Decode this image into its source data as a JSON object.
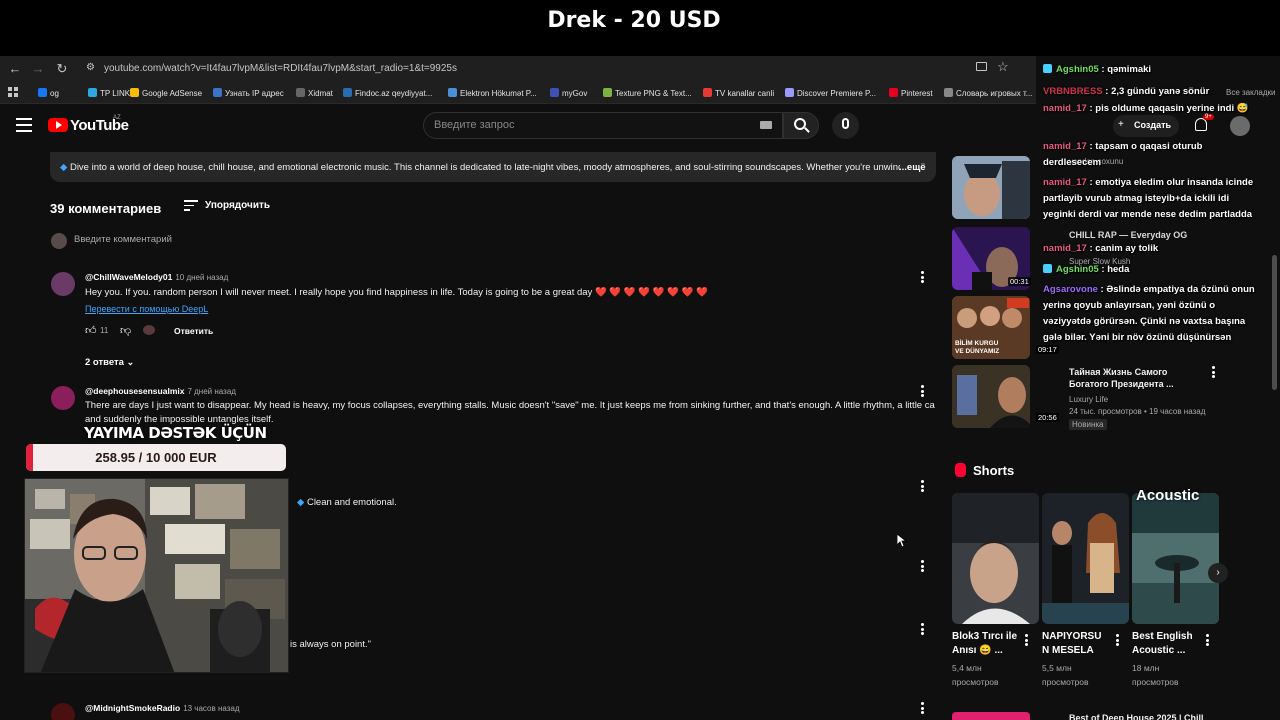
{
  "stream": {
    "banner_title": "Drek - 20 USD",
    "support_label": "YAYIMA DƏSTƏK ÜÇÜN",
    "donation_text": "258.95 / 10 000 EUR",
    "donation_progress": 0.026
  },
  "browser": {
    "url": "youtube.com/watch?v=It4fau7lvpM&list=RDIt4fau7lvpM&start_radio=1&t=9925s",
    "bookmarks": [
      {
        "label": "og",
        "color": "#1877f2"
      },
      {
        "label": "TP LINK",
        "color": "#2ea7e0"
      },
      {
        "label": "Google AdSense",
        "color": "#fbbc04"
      },
      {
        "label": "Узнать IP адрес",
        "color": "#3a74c4"
      },
      {
        "label": "Xidmat",
        "color": "#666666"
      },
      {
        "label": "Findoc.az qeydiyyat...",
        "color": "#2b6cb0"
      },
      {
        "label": "Elektron Hökumət P...",
        "color": "#4a90d9"
      },
      {
        "label": "myGov",
        "color": "#3f51b5"
      },
      {
        "label": "Texture PNG & Text...",
        "color": "#7cb342"
      },
      {
        "label": "TV kanallar canli",
        "color": "#e53935"
      },
      {
        "label": "Discover Premiere P...",
        "color": "#9999ff"
      },
      {
        "label": "Pinterest",
        "color": "#e60023"
      },
      {
        "label": "Словарь игровых т...",
        "color": "#888888"
      }
    ],
    "all_bookmarks": "Все закладки"
  },
  "youtube": {
    "logo_text": "YouTube",
    "region": "AZ",
    "search_placeholder": "Введите запрос",
    "create_label": "Создать",
    "notif_count": "9+"
  },
  "description": {
    "text": "Dive into a world of deep house, chill house, and emotional electronic music. This channel is dedicated to late-night vibes, moody atmospheres, and soul-stirring soundscapes. Whether you're unwindin",
    "more": "...ещё"
  },
  "comments_section": {
    "count_label": "39 комментариев",
    "sort_label": "Упорядочить",
    "input_placeholder": "Введите комментарий",
    "comments": [
      {
        "author": "@ChillWaveMelody01",
        "time": "10 дней назад",
        "text": "Hey you. If you. random person I will never meet. I really hope you find happiness in life. Today is going to be a great day ❤️ ❤️ ❤️ ❤️ ❤️ ❤️ ❤️ ❤️",
        "translate": "Перевести с помощью DeepL",
        "likes": "11",
        "reply": "Ответить",
        "replies": "2 ответа"
      },
      {
        "author": "@deephousesensualmix",
        "time": "7 дней назад",
        "text_line1": "There are days I just want to disappear. My head is heavy, my focus collapses, everything stalls. Music doesn't \"save\" me. It just keeps me from sinking further, and that's enough. A little rhythm, a little calm,",
        "text_line2": "and suddenly the impossible untangles itself."
      }
    ],
    "partial_text_1": "Clean and emotional.",
    "partial_text_2": "is always on point.\"",
    "partial_reply": "Ответить",
    "last_author": "@MidnightSmokeRadio",
    "last_time": "13 часов назад"
  },
  "chat": [
    {
      "user": "Agshin05",
      "color": "#6fe05a",
      "text": "qəmimaki"
    },
    {
      "user": "VRBNBRESS",
      "color": "#d1344f",
      "text": "2,3 gündü yanə sönür"
    },
    {
      "user": "namid_17",
      "color": "#e85a80",
      "text": "pis oldume qaqasin yerine indi 😅"
    },
    {
      "user": "namid_17",
      "color": "#e85a80",
      "text": "tapsam o qaqasi oturub derdlesecem"
    },
    {
      "user": "namid_17",
      "color": "#e85a80",
      "text": "emotiya eledim olur insanda icinde partlayib vurub atmag isteyib+da ickili idi yeginki derdi var mende nese dedim partladda"
    },
    {
      "user": "namid_17",
      "color": "#e85a80",
      "text": "canim ay tolik"
    },
    {
      "user": "Agshin05",
      "color": "#6fe05a",
      "text": "heda"
    },
    {
      "user": "Agsarovone",
      "color": "#9b6bff",
      "text": "Əslində empatiya da özünü onun yerinə qoyub anlayırsan, yəni özünü o vəziyyətdə görürsən. Çünki nə vaxtsa başına gələ bilər. Yəni bir növ özünü düşünürsən"
    }
  ],
  "sidebar": {
    "videos": [
      {
        "title": "",
        "meta": "yandan çoxunu",
        "duration": ""
      },
      {
        "title": "CHILL RAP — Everyday OG",
        "meta": "Super Slow Kush",
        "duration": "00:31"
      },
      {
        "title": "",
        "meta": "",
        "duration": "09:17",
        "thumb_caption": "BİLİM KURGU VE DÜNYAMIZ"
      },
      {
        "title": "Тайная Жизнь Самого Богатого Президента ...",
        "meta": "Luxury Life",
        "meta2": "24 тыс. просмотров • 19 часов назад",
        "badge": "Новинка",
        "duration": "20:56"
      }
    ],
    "shorts_title": "Shorts",
    "shorts": [
      {
        "title": "Blok3 Tırcı ile Anısı 😄 ...",
        "views": "5,4 млн",
        "views_label": "просмотров"
      },
      {
        "title": "NAPIYORSU N MESELA",
        "views": "5,5 млн",
        "views_label": "просмотров"
      },
      {
        "title": "Best English Acoustic ...",
        "views": "18 млн",
        "views_label": "просмотров",
        "thumb_label": "Acoustic"
      }
    ],
    "next_title": "Best of Deep House 2025 | Chill"
  },
  "colors": {
    "background": "#0f0f0f",
    "youtube_red": "#ff0000",
    "donation_red": "#e0213e",
    "link_blue": "#3ea6ff"
  }
}
